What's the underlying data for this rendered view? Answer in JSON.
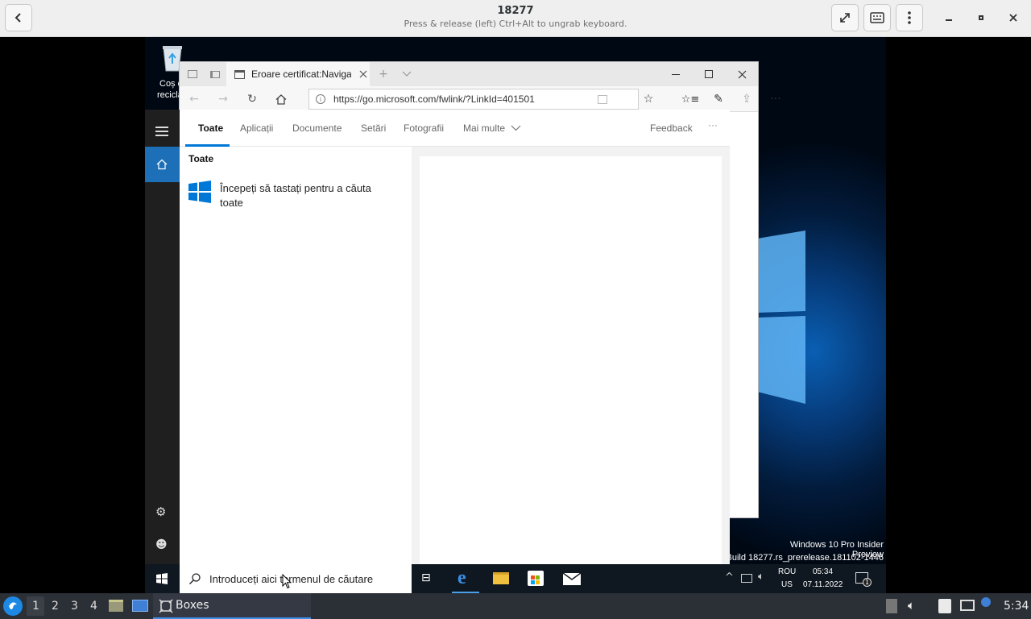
{
  "host": {
    "title": "18277",
    "subtitle": "Press & release (left) Ctrl+Alt to ungrab keyboard."
  },
  "desktop": {
    "recycle_bin_label_1": "Coș d",
    "recycle_bin_label_2": "recicla",
    "watermark_line1": "Windows 10 Pro Insider Preview",
    "watermark_line2": "e. Build 18277.rs_prerelease.181102-1446"
  },
  "edge": {
    "tab_title": "Eroare certificat:Navigaț",
    "url": "https://go.microsoft.com/fwlink/?LinkId=401501"
  },
  "search": {
    "tabs": [
      "Toate",
      "Aplicații",
      "Documente",
      "Setări",
      "Fotografii",
      "Mai multe"
    ],
    "feedback": "Feedback",
    "more": "···",
    "section_heading": "Toate",
    "hint_line1": "Începeți să tastați pentru a căuta",
    "hint_line2": "toate",
    "placeholder": "Introduceți aici termenul de căutare"
  },
  "tray": {
    "lang1": "ROU",
    "lang2": "US",
    "time": "05:34",
    "date": "07.11.2022",
    "notif_count": "1"
  },
  "linux_panel": {
    "workspaces": [
      "1",
      "2",
      "3",
      "4"
    ],
    "task_label": "Boxes",
    "clock": "5:34"
  },
  "colors": {
    "accent": "#0078d7",
    "taskbar": "#0f1720",
    "panel": "#2b2f36"
  }
}
